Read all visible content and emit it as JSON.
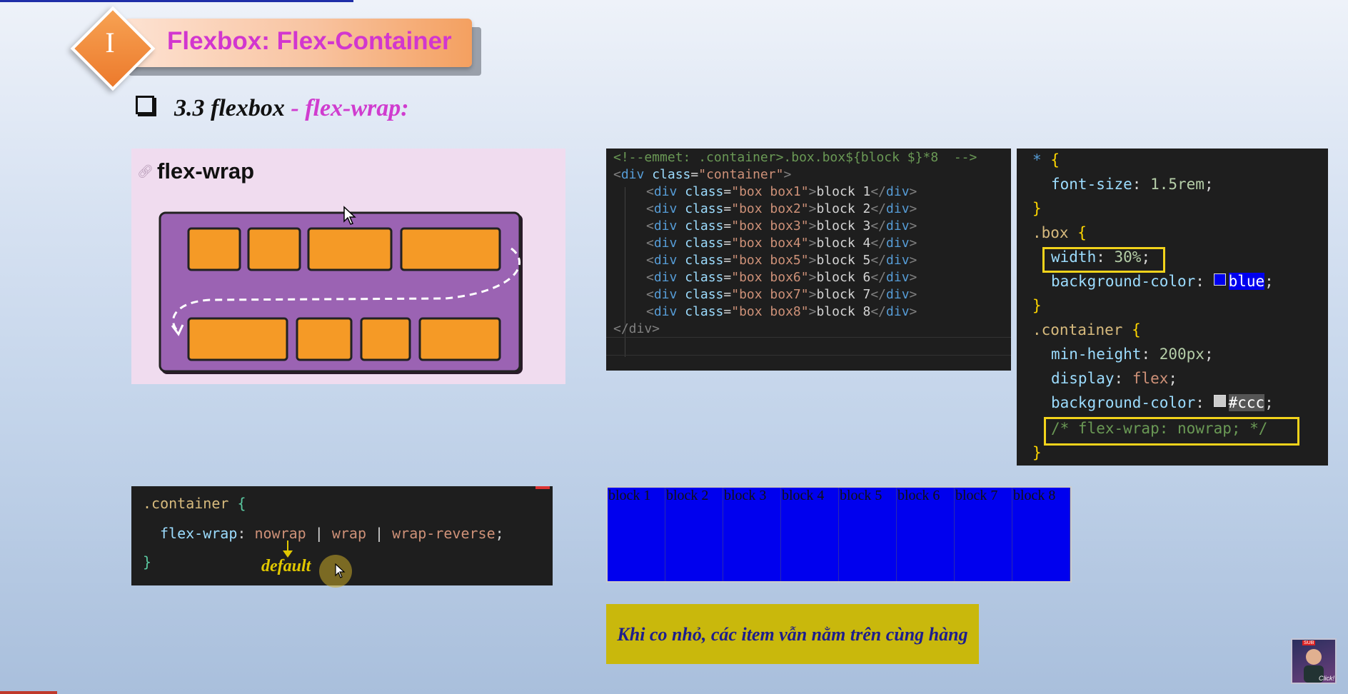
{
  "header": {
    "section_number": "I",
    "title": "Flexbox: Flex-Container"
  },
  "subtitle": {
    "part_a": "3.3 flexbox",
    "separator": " - ",
    "part_b": "flex-wrap:"
  },
  "illustration": {
    "title": "flex-wrap",
    "link_icon": "link-icon"
  },
  "html_code": {
    "comment": "<!--emmet: .container>.box.box${block $}*8  -->",
    "open_tag": "div",
    "container_class": "container",
    "box_tag": "div",
    "boxes": [
      {
        "class": "box box1",
        "text": "block 1"
      },
      {
        "class": "box box2",
        "text": "block 2"
      },
      {
        "class": "box box3",
        "text": "block 3"
      },
      {
        "class": "box box4",
        "text": "block 4"
      },
      {
        "class": "box box5",
        "text": "block 5"
      },
      {
        "class": "box box6",
        "text": "block 6"
      },
      {
        "class": "box box7",
        "text": "block 7"
      },
      {
        "class": "box box8",
        "text": "block 8"
      }
    ],
    "close_tag": "</div>"
  },
  "css_code": {
    "universal": {
      "selector": "*",
      "prop": "font-size",
      "value": "1.5rem"
    },
    "box": {
      "selector": ".box",
      "width_prop": "width",
      "width_value": "30%",
      "bg_prop": "background-color",
      "bg_value": "blue",
      "bg_color": "#0000ee"
    },
    "container": {
      "selector": ".container",
      "min_height_prop": "min-height",
      "min_height_value": "200px",
      "display_prop": "display",
      "display_value": "flex",
      "bg_prop": "background-color",
      "bg_value": "#ccc",
      "bg_color": "#cccccc",
      "comment": "/* flex-wrap: nowrap; */"
    }
  },
  "syntax": {
    "selector": ".container",
    "prop": "flex-wrap",
    "values": [
      "nowrap",
      "wrap",
      "wrap-reverse"
    ],
    "default_label": "default"
  },
  "demo": {
    "boxes": [
      "block 1",
      "block 2",
      "block 3",
      "block 4",
      "block 5",
      "block 6",
      "block 7",
      "block 8"
    ]
  },
  "caption": {
    "text": "Khi co nhỏ, các item vẫn nằm trên cùng hàng"
  },
  "colors": {
    "accent_pink": "#d236cf",
    "accent_orange": "#ec7a2c",
    "caption_bg": "#c9b80c",
    "demo_blue": "#0000ee"
  }
}
